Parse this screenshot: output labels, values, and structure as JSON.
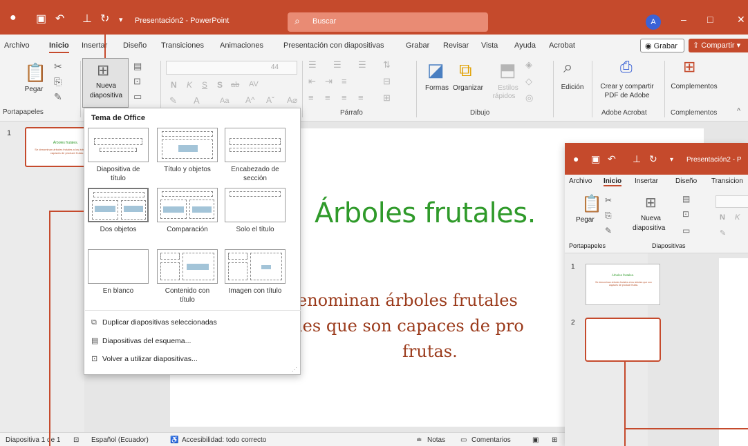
{
  "titlebar": {
    "title": "Presentación2 - PowerPoint",
    "search_placeholder": "Buscar",
    "avatar_initial": "A",
    "controls": [
      "–",
      "□",
      "✕"
    ]
  },
  "menu": {
    "items": [
      "Archivo",
      "Inicio",
      "Insertar",
      "Diseño",
      "Transiciones",
      "Animaciones",
      "Presentación con diapositivas",
      "Grabar",
      "Revisar",
      "Vista",
      "Ayuda",
      "Acrobat"
    ],
    "active": "Inicio",
    "grabar_button": "Grabar",
    "share_button": "Compartir"
  },
  "ribbon": {
    "paste_label": "Pegar",
    "new_slide_line1": "Nueva",
    "new_slide_line2": "diapositiva",
    "font_size": "44",
    "format_letters": [
      "N",
      "K",
      "S",
      "S",
      "ab",
      "AV"
    ],
    "case_label": "Aa",
    "shapes_label": "Formas",
    "arrange_label": "Organizar",
    "styles_line1": "Estilos",
    "styles_line2": "rápidos",
    "edit_label": "Edición",
    "adobe_line1": "Crear y compartir",
    "adobe_line2": "PDF de Adobe",
    "addins_label": "Complementos",
    "groups": {
      "clipboard": "Portapapeles",
      "paragraph": "Párrafo",
      "drawing": "Dibujo",
      "adobe": "Adobe Acrobat",
      "addins": "Complementos"
    }
  },
  "layout_menu": {
    "header": "Tema de Office",
    "layouts": [
      {
        "line1": "Diapositiva de",
        "line2": "título"
      },
      {
        "line1": "Título y objetos",
        "line2": ""
      },
      {
        "line1": "Encabezado de",
        "line2": "sección"
      },
      {
        "line1": "Dos objetos",
        "line2": ""
      },
      {
        "line1": "Comparación",
        "line2": ""
      },
      {
        "line1": "Solo el título",
        "line2": ""
      },
      {
        "line1": "En blanco",
        "line2": ""
      },
      {
        "line1": "Contenido con",
        "line2": "título"
      },
      {
        "line1": "Imagen con título",
        "line2": ""
      }
    ],
    "commands": [
      "Duplicar diapositivas seleccionadas",
      "Diapositivas del esquema...",
      "Volver a utilizar diapositivas..."
    ]
  },
  "thumbnails": {
    "number": "1",
    "title": "Árboles frutales.",
    "body": "Se denominan árboles frutales a los árboles que son capaces de producir frutas."
  },
  "slide": {
    "title": "Árboles frutales.",
    "body_line1": "enominan árboles frutales",
    "body_line2": "les que son capaces de pro",
    "body_line3": "frutas."
  },
  "statusbar": {
    "slide_count": "Diapositiva 1 de 1",
    "language": "Español (Ecuador)",
    "accessibility": "Accesibilidad: todo correcto",
    "notes": "Notas",
    "comments": "Comentarios"
  },
  "second_window": {
    "title": "Presentación2 - P",
    "menu_items": [
      "Archivo",
      "Inicio",
      "Insertar",
      "Diseño",
      "Transicion"
    ],
    "paste_label": "Pegar",
    "new_slide_line1": "Nueva",
    "new_slide_line2": "diapositiva",
    "groups": [
      "Portapapeles",
      "Diapositivas"
    ],
    "thumb_numbers": [
      "1",
      "2"
    ],
    "thumb_title": "Árboles frutales.",
    "thumb_body": "Se denominan árboles frutales a los árboles que son capaces de producir frutas.",
    "format_letters": [
      "N",
      "K"
    ]
  },
  "colors": {
    "accent": "#c54a2c",
    "title_green": "#2f9a2a",
    "body_brown": "#9b3b1c"
  }
}
